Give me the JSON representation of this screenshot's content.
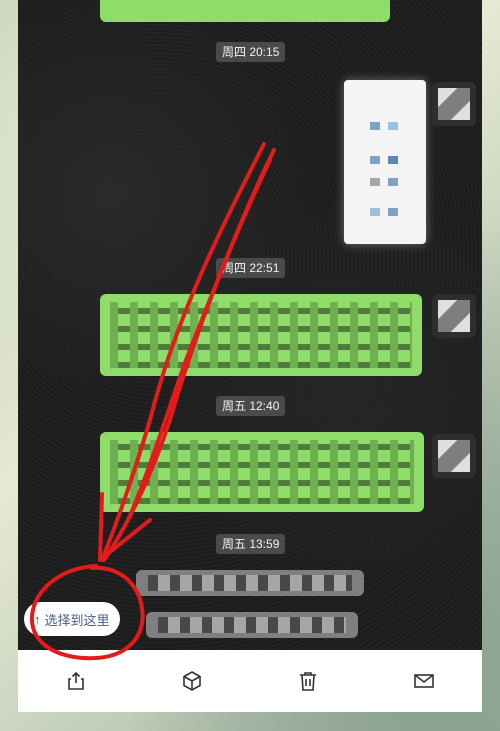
{
  "chat": {
    "timestamps": [
      "周四 20:15",
      "周四 22:51",
      "周五 12:40",
      "周五 13:59"
    ]
  },
  "select_pill": {
    "arrow": "↑",
    "label": "选择到这里"
  },
  "toolbar": {
    "items": [
      {
        "icon": "share-icon"
      },
      {
        "icon": "box-icon"
      },
      {
        "icon": "trash-icon"
      },
      {
        "icon": "mail-icon"
      }
    ]
  },
  "colors": {
    "bubble_green": "#8fdc6a",
    "annotation_red": "#e31b1b",
    "pill_text": "#4a5a8c"
  }
}
